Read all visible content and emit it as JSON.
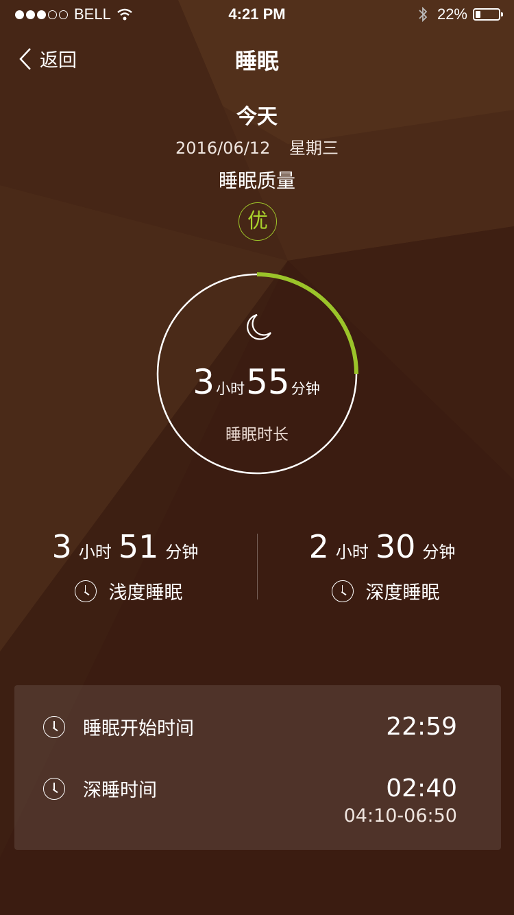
{
  "status_bar": {
    "carrier": "BELL",
    "time": "4:21 PM",
    "battery_text": "22%",
    "battery_level": 0.22
  },
  "nav": {
    "back_label": "返回",
    "title": "睡眠"
  },
  "summary": {
    "day_label": "今天",
    "date": "2016/06/12",
    "weekday": "星期三",
    "quality_label": "睡眠质量",
    "quality_grade": "优"
  },
  "ring": {
    "progress": 0.25,
    "hours": "3",
    "hours_unit": "小时",
    "minutes": "55",
    "minutes_unit": "分钟",
    "label": "睡眠时长",
    "accent_color": "#9bc42a"
  },
  "light_sleep": {
    "hours": "3",
    "hours_unit": "小时",
    "minutes": "51",
    "minutes_unit": "分钟",
    "label": "浅度睡眠"
  },
  "deep_sleep": {
    "hours": "2",
    "hours_unit": "小时",
    "minutes": "30",
    "minutes_unit": "分钟",
    "label": "深度睡眠"
  },
  "details": {
    "start_label": "睡眠开始时间",
    "start_value": "22:59",
    "deep_label": "深睡时间",
    "deep_value": "02:40",
    "deep_range": "04:10-06:50"
  },
  "colors": {
    "background": "#3a1b10",
    "accent": "#9bc42a"
  }
}
